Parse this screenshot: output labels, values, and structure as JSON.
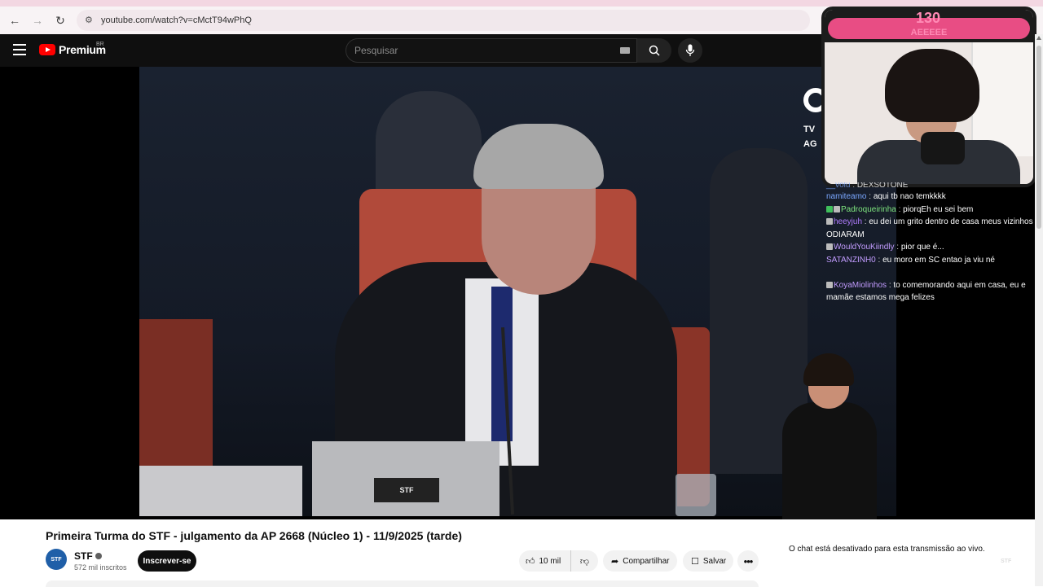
{
  "browser": {
    "url": "youtube.com/watch?v=cMctT94wPhQ"
  },
  "header": {
    "logo_text": "Premium",
    "logo_country": "BR",
    "search_placeholder": "Pesquisar"
  },
  "overlay": {
    "follower_count": "130",
    "follower_sub": "AEEEEE",
    "tv_logo_text": "TV",
    "tv_logo_text2": "AG",
    "laptop_logo": "STF",
    "corner_logo": "STF"
  },
  "chat": {
    "messages": [
      {
        "user": "__volu",
        "text": "DEXSOTONE"
      },
      {
        "user": "namiteamo",
        "text": "aqui tb nao temkkkk"
      },
      {
        "user": "Padroqueirinha",
        "text": "piorqEh eu sei bem"
      },
      {
        "user": "heeyjuh",
        "text": "eu dei um grito dentro de casa meus vizinhos ODIARAM"
      },
      {
        "user": "WouldYouKiindly",
        "text": "pior que é..."
      },
      {
        "user": "SATANZINH0",
        "text": "eu moro em SC entao ja viu né"
      },
      {
        "user": "KoyaMiolinhos",
        "text": "to comemorando aqui em casa, eu e mamãe estamos mega felizes"
      }
    ]
  },
  "video": {
    "title": "Primeira Turma do STF - julgamento da AP 2668 (Núcleo 1) - 11/9/2025 (tarde)",
    "channel": "STF",
    "channel_avatar_text": "STF",
    "subscribers": "572 mil inscritos",
    "subscribe_label": "Inscrever-se",
    "likes": "10 mil",
    "share_label": "Compartilhar",
    "save_label": "Salvar",
    "more_label": "•••",
    "chat_disabled": "O chat está desativado para esta transmissão ao vivo."
  }
}
